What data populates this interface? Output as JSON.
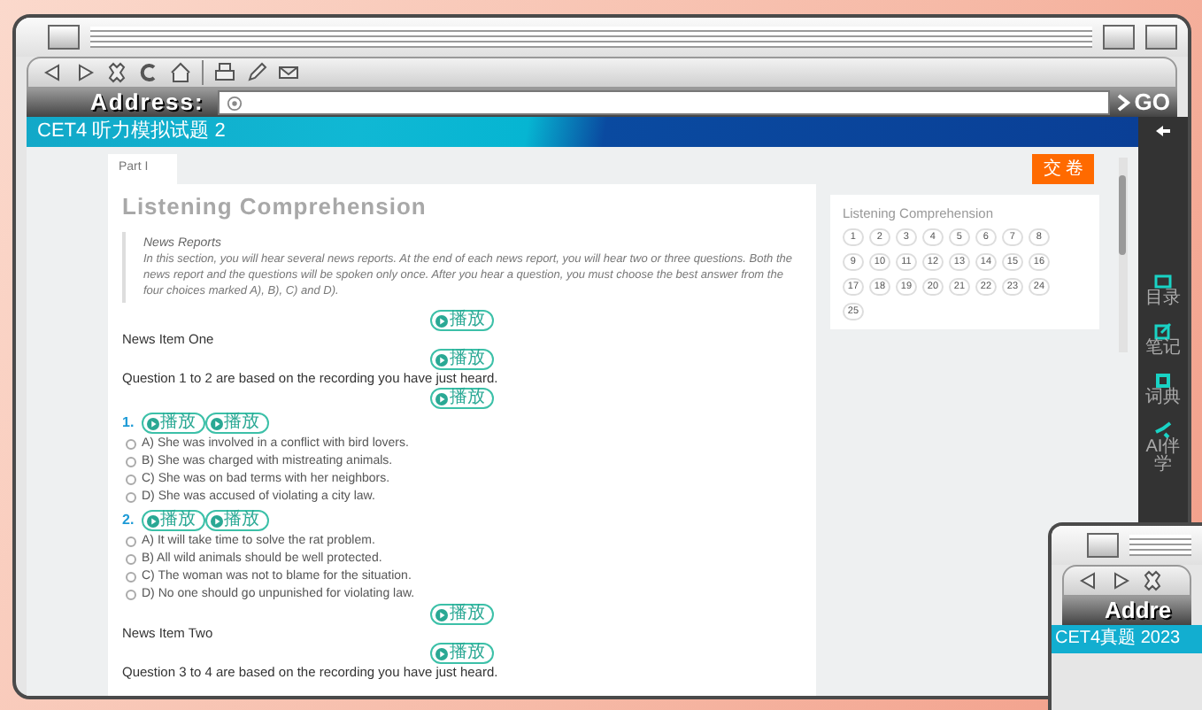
{
  "address_bar": {
    "label": "Address:",
    "go": "GO"
  },
  "page": {
    "title": "CET4 听力模拟试题 2",
    "tab": "Part I",
    "heading": "Listening Comprehension",
    "directions": {
      "title": "News Reports",
      "text": "In this section, you will hear several news reports. At the end of each news report, you will hear two or three questions. Both the news report and the questions will be spoken only once. After you hear a question, you must choose the best answer from the four choices marked A), B), C) and D)."
    },
    "items": [
      {
        "kind": "play",
        "buttons": [
          "播放"
        ]
      },
      {
        "kind": "text",
        "text": "News Item One"
      },
      {
        "kind": "play",
        "buttons": [
          "播放"
        ]
      },
      {
        "kind": "text",
        "text": "Question 1 to 2 are based on the recording you have just heard."
      },
      {
        "kind": "play",
        "buttons": [
          "播放"
        ]
      },
      {
        "kind": "question",
        "number": "1.",
        "buttons": [
          "播放",
          "播放"
        ],
        "options": [
          {
            "text": "A) She was involved in a conflict with bird lovers.",
            "selected": false
          },
          {
            "text": "B) She was charged with mistreating animals.",
            "selected": false
          },
          {
            "text": "C) She was on bad terms with her neighbors.",
            "selected": false
          },
          {
            "text": "D) She was accused of violating a city law.",
            "selected": false
          }
        ]
      },
      {
        "kind": "question",
        "number": "2.",
        "buttons": [
          "播放",
          "播放"
        ],
        "options": [
          {
            "text": "A) It will take time to solve the rat problem.",
            "selected": false
          },
          {
            "text": "B) All wild animals should be well protected.",
            "selected": false
          },
          {
            "text": "C) The woman was not to blame for the situation.",
            "selected": false
          },
          {
            "text": "D) No one should go unpunished for violating law.",
            "selected": false
          }
        ]
      },
      {
        "kind": "play",
        "buttons": [
          "播放"
        ]
      },
      {
        "kind": "text",
        "text": "News Item Two"
      },
      {
        "kind": "play",
        "buttons": [
          "播放"
        ]
      },
      {
        "kind": "text",
        "text": "Question 3 to 4 are based on the recording you have just heard."
      }
    ],
    "submit": "交 卷",
    "panel": {
      "title": "Listening Comprehension",
      "numbers": [
        "1",
        "2",
        "3",
        "4",
        "5",
        "6",
        "7",
        "8",
        "9",
        "10",
        "11",
        "12",
        "13",
        "14",
        "15",
        "16",
        "17",
        "18",
        "19",
        "20",
        "21",
        "22",
        "23",
        "24",
        "25"
      ]
    },
    "sidebar": [
      {
        "label": "目录"
      },
      {
        "label": "笔记"
      },
      {
        "label": "词典"
      },
      {
        "label": "AI伴学"
      }
    ]
  },
  "second_window": {
    "address_label": "Addre",
    "title": "CET4真题 2023"
  }
}
